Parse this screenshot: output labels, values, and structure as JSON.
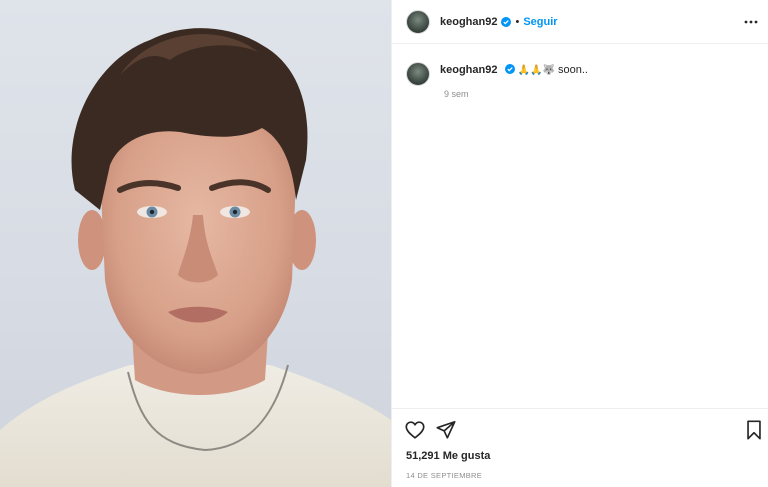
{
  "post": {
    "username": "keoghan92",
    "follow_label": "Seguir",
    "header_separator": "•",
    "caption_emojis": "🙏🙏🐺",
    "caption_text": "soon..",
    "time_ago": "9 sem",
    "likes": "51,291 Me gusta",
    "date": "14 DE SEPTIEMBRE"
  },
  "icons": {
    "verified": "verified-badge-icon",
    "more": "more-options-icon",
    "like": "heart-icon",
    "share": "paper-plane-icon",
    "save": "bookmark-icon"
  },
  "colors": {
    "accent": "#0095f6",
    "text": "#262626",
    "muted": "#8e8e8e",
    "border": "#efefef"
  }
}
